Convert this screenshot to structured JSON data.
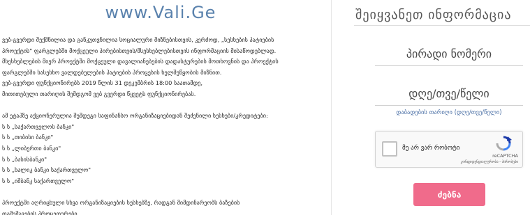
{
  "brand": {
    "title": "www.Vali.Ge"
  },
  "info_text": {
    "paragraph1": [
      "ვებ-გვერდი შექმნილია და განკუთვნილია სოციალური მიზნებისთვის, კერძოდ, „სესხების პატიების",
      "პროექტის\" ფარგლებში მოქცეული პირებისთვის/მსესხებლებისთვის ინფორმაციის მისაწოდებლად.",
      "მსესხებლების მიერ პროექტში მოქცეული დავალიანებების დადასტურების მოთხოვნის და პროექტის",
      "ფარგლებში სასესხო ვალდებულების პატიების პროცესის ხელშეწყობის მიზნით."
    ],
    "paragraph2": [
      "ვებ-გვერდი ფუნქციონირებს 2019 წლის 31 დეკემბრის 18:00 საათამდე,",
      "მითითებული თარიღის შემდგომ ვებ გვერდი წყვეტს ფუნქციონირებას."
    ],
    "lenders_intro": "ამ ეტაპზე აქციონერულია შემდეგი საფინანსო ორგანიზაციებიდან შეძენილი სესხები/კრედიტები:",
    "lenders": [
      "ს ს „საქართველოს ბანკი\"",
      "ს ს „თიბისი ბანკი\"",
      "ს ს „ლიბერთი ბანკი\"",
      "ს ს „ბასისბანკი\"",
      "ს ს „ხალიკ ბანკი საქართველო\"",
      "ს ს „იშბანკ საქართველო\""
    ],
    "paragraph3": [
      "პროექტში აღრიცხული სხვა ორგანიზაციების სესხებზე, რადგან მიმდინარეობს ბაზების",
      "დამუშავების პროცედურები."
    ]
  },
  "form": {
    "title": "შეიყვანეთ ინფორმაცია",
    "personal_number_placeholder": "პირადი ნომერი",
    "birthdate_placeholder": "დღე/თვე/წელი",
    "birthdate_hint": "დაბადების თარიღი (დღე/თვე/წელი)",
    "captcha": {
      "label": "მე არ ვარ რობოტი",
      "brand": "reCAPTCHA",
      "terms": "კონფიდენციალურობა - პირობები"
    },
    "submit_label": "ძებნა"
  },
  "colors": {
    "brand": "#5a82ad",
    "button": "#f06b8b",
    "hint": "#4a6fa5"
  }
}
